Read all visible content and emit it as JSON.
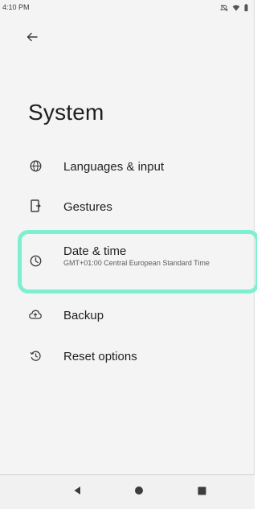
{
  "status_bar": {
    "time": "4:10 PM",
    "icons": [
      "silent-icon",
      "wifi-icon",
      "battery-icon"
    ]
  },
  "header": {
    "back_icon": "back-arrow-icon"
  },
  "page": {
    "title": "System"
  },
  "settings": {
    "items": [
      {
        "label": "Languages & input",
        "icon": "globe-icon"
      },
      {
        "label": "Gestures",
        "icon": "gestures-phone-icon"
      },
      {
        "label": "Date & time",
        "summary": "GMT+01:00 Central European Standard Time",
        "icon": "clock-icon",
        "highlighted": true
      },
      {
        "label": "Backup",
        "icon": "cloud-upload-icon"
      },
      {
        "label": "Reset options",
        "icon": "history-icon"
      }
    ]
  },
  "nav_bar": {
    "buttons": [
      "back-triangle-icon",
      "home-circle-icon",
      "recents-square-icon"
    ]
  },
  "colors": {
    "highlight": "#7df0cf",
    "background": "#f4f4f4",
    "text": "#1f1f1f"
  }
}
